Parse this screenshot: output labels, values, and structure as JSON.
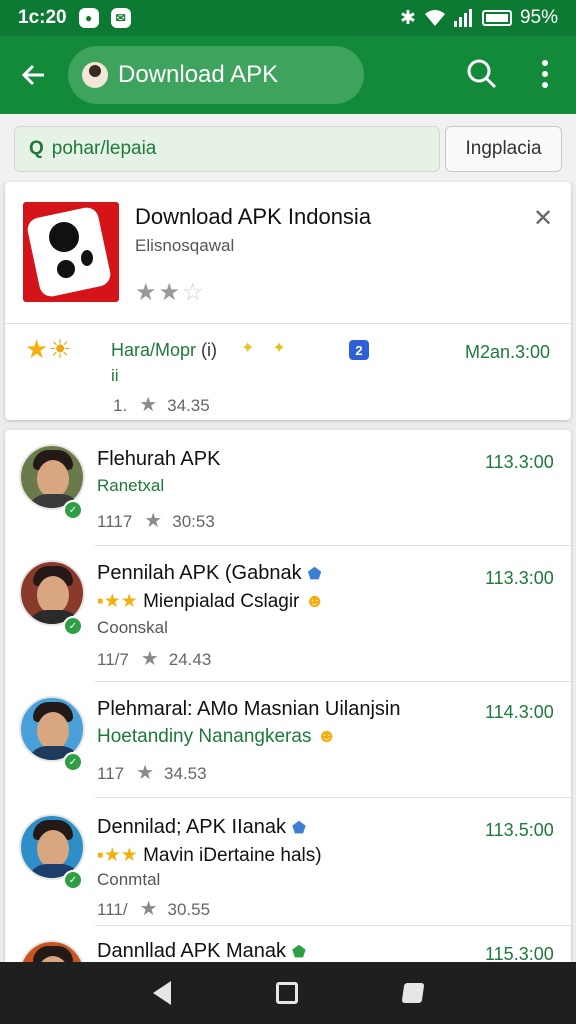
{
  "status": {
    "time": "1c:20",
    "battery": "95%"
  },
  "app_bar": {
    "title": "Download APK",
    "back_icon": "arrow-left-icon",
    "search_icon": "search-icon",
    "menu_icon": "more-vert-icon"
  },
  "filter": {
    "query": "pohar/lepaia",
    "button": "Ingplacia"
  },
  "featured": {
    "title": "Download APK Indonsia",
    "subtitle": "Elisnosqawal",
    "rating_stars": 2,
    "label": "Hara/Mopr",
    "label_suffix": "(i)",
    "label2": "ii",
    "badge": "2",
    "price": "M2an.3:00",
    "meta_count": "1.",
    "meta_size": "34.35"
  },
  "items": [
    {
      "title": "Flehurah APK",
      "line2": "Ranetxal",
      "line3": "",
      "count": "1117",
      "size": "30:53",
      "price": "113.3:00"
    },
    {
      "title": "Pennilah APK (Gabnak",
      "line2": "Mienpialad Cslagir",
      "line3": "Coonskal",
      "count": "11/7",
      "size": "24.43",
      "price": "113.3:00"
    },
    {
      "title": "Plehmaral: AMo Masnian Uilanjsin",
      "line2": "Hoetandiny Nanangkeras",
      "line3": "",
      "count": "117",
      "size": "34.53",
      "price": "114.3:00"
    },
    {
      "title": "Dennilad; APK IIanak",
      "line2": "Mavin iDertaine hals)",
      "line3": "Conmtal",
      "count": "111/",
      "size": "30.55",
      "price": "113.5:00"
    },
    {
      "title": "Dannllad APK Manak",
      "line2": "",
      "line3": "",
      "count": "",
      "size": "",
      "price": "115.3:00"
    }
  ],
  "colors": {
    "primary": "#138a3a",
    "status": "#0d7a33",
    "accent_text": "#1d7a3a"
  }
}
